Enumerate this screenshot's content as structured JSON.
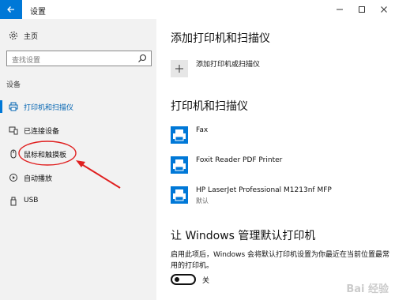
{
  "window": {
    "title": "设置",
    "controls": {
      "minimize": "—",
      "maximize": "☐",
      "close": "✕"
    }
  },
  "sidebar": {
    "home_label": "主页",
    "search_placeholder": "查找设置",
    "section_label": "设备",
    "items": [
      {
        "label": "打印机和扫描仪",
        "icon": "printer-icon",
        "active": true
      },
      {
        "label": "已连接设备",
        "icon": "connected-devices-icon",
        "active": false
      },
      {
        "label": "鼠标和触摸板",
        "icon": "mouse-icon",
        "active": false
      },
      {
        "label": "自动播放",
        "icon": "autoplay-icon",
        "active": false
      },
      {
        "label": "USB",
        "icon": "usb-icon",
        "active": false
      }
    ]
  },
  "main": {
    "add_heading": "添加打印机和扫描仪",
    "add_button_label": "添加打印机或扫描仪",
    "list_heading": "打印机和扫描仪",
    "printers": [
      {
        "name": "Fax",
        "status": ""
      },
      {
        "name": "Foxit Reader PDF Printer",
        "status": ""
      },
      {
        "name": "HP LaserJet Professional M1213nf MFP",
        "status": "默认"
      }
    ],
    "default_heading": "让 Windows 管理默认打印机",
    "default_desc": "启用此项后，Windows 会将默认打印机设置为你最近在当前位置最常用的打印机。",
    "toggle_label": "关",
    "toggle_on": false
  },
  "annotation": {
    "highlight_color": "#e02020"
  },
  "watermark_text": "Bai 经验"
}
